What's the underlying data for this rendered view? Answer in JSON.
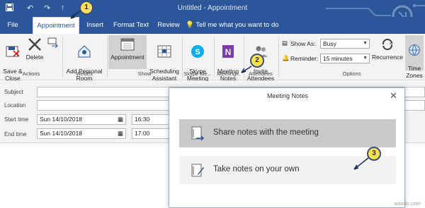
{
  "window": {
    "title": "Untitled  -  Appointment"
  },
  "tabs": [
    {
      "label": "File"
    },
    {
      "label": "Appointment"
    },
    {
      "label": "Insert"
    },
    {
      "label": "Format Text"
    },
    {
      "label": "Review"
    }
  ],
  "tell_me": "Tell me what you want to do",
  "ribbon": {
    "actions": {
      "save_close": "Save &\nClose",
      "delete": "Delete",
      "group": "Actions"
    },
    "webex": {
      "personal_room": "Add Personal\nRoom",
      "group": "WebEx"
    },
    "show": {
      "appointment": "Appointment",
      "scheduling": "Scheduling\nAssistant",
      "group": "Show"
    },
    "skype": {
      "label": "Skype\nMeeting",
      "group": "Skype Me..."
    },
    "meeting_notes": {
      "label": "Meeting\nNotes",
      "group": "Meeting..."
    },
    "attendees": {
      "label": "Invite\nAttendees",
      "group": "Attendees"
    },
    "options": {
      "show_as_label": "Show As:",
      "show_as_value": "Busy",
      "reminder_label": "Reminder:",
      "reminder_value": "15 minutes",
      "recurrence": "Recurrence",
      "time_zones": "Time\nZones",
      "group": "Options"
    }
  },
  "form": {
    "subject_label": "Subject",
    "location_label": "Location",
    "start_label": "Start time",
    "start_date": "Sun 14/10/2018",
    "start_time": "16:30",
    "end_label": "End time",
    "end_date": "Sun 14/10/2018",
    "end_time": "17:00"
  },
  "dialog": {
    "title": "Meeting Notes",
    "option_share": "Share notes with the meeting",
    "option_own": "Take notes on your own"
  },
  "callouts": [
    "1",
    "2",
    "3"
  ],
  "watermark": "wsxdn.com",
  "colors": {
    "brand": "#2b579a",
    "callout_fill": "#ffe14d",
    "onenote": "#7b3ea3"
  }
}
